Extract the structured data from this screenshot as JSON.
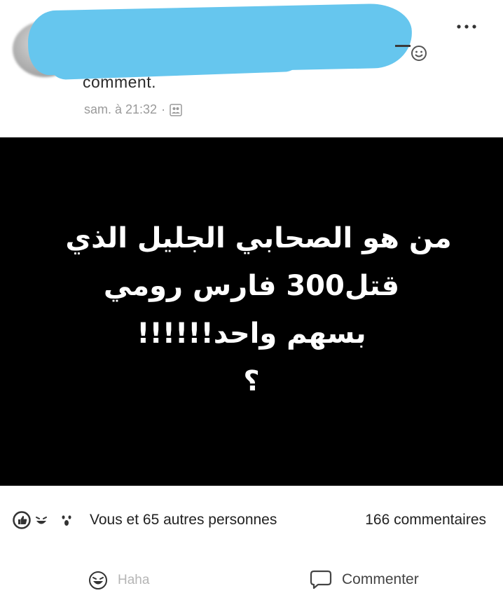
{
  "header": {
    "author_name": "[redacted]",
    "activity_text": "comment.",
    "timestamp": "sam. à 21:32",
    "separator": "·",
    "more_icon": "more-horizontal-icon",
    "audience_icon": "friends-icon",
    "redaction_color": "#66c6ee"
  },
  "post": {
    "image_background": "#000000",
    "text_lines": [
      "من هو الصحابي الجليل الذي",
      "قتل300 فارس رومي",
      "بسهم واحد!!!!!!",
      "؟"
    ]
  },
  "reactions": {
    "icons": [
      "like-icon",
      "laugh-icon",
      "wow-icon"
    ],
    "summary": "Vous et 65 autres personnes",
    "comments_count": "166 commentaires"
  },
  "actions": {
    "haha_label": "Haha",
    "comment_label": "Commenter"
  },
  "colors": {
    "like_blue": "#3b5998",
    "reaction_yellow": "#ffffff",
    "muted_text": "#9a9a9a"
  }
}
